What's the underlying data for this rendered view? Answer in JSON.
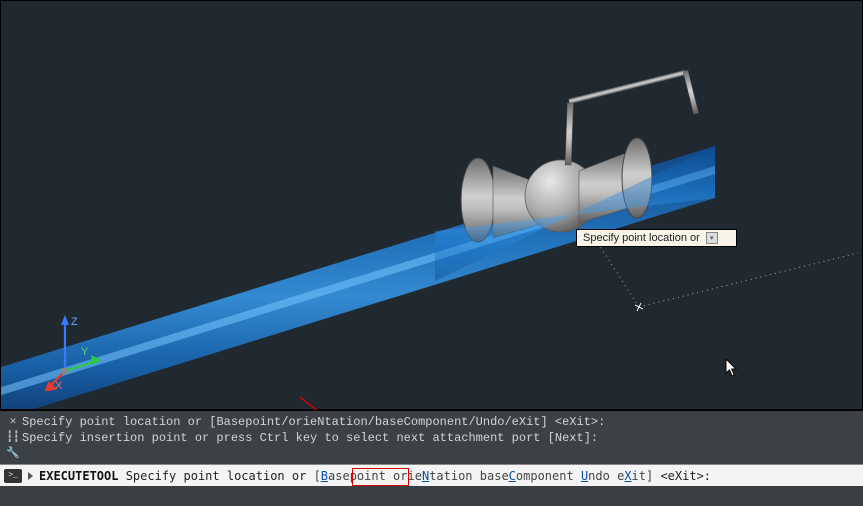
{
  "tooltip": {
    "text": "Specify point location or"
  },
  "ucs": {
    "x_label": "X",
    "y_label": "Y",
    "z_label": "Z"
  },
  "history": {
    "line1_pre": "Specify point location or [",
    "line1_opts": "Basepoint/orieNtation/baseComponent/Undo/eXit",
    "line1_post": "] <eXit>:",
    "line2": "Specify insertion point or press Ctrl key to select next attachment port [Next]:"
  },
  "cli": {
    "command": "EXECUTETOOL",
    "prompt_pre": " Specify point location or ",
    "bracket_open": "[",
    "opts": [
      {
        "u": "B",
        "rest": "asepoint"
      },
      {
        "pre": " orie",
        "u": "N",
        "rest": "tation"
      },
      {
        "pre": " base",
        "u": "C",
        "rest": "omponent"
      },
      {
        "pre": " ",
        "u": "U",
        "rest": "ndo"
      },
      {
        "pre": " e",
        "u": "X",
        "rest": "it"
      }
    ],
    "bracket_close": "]",
    "default": " <eXit>:"
  }
}
